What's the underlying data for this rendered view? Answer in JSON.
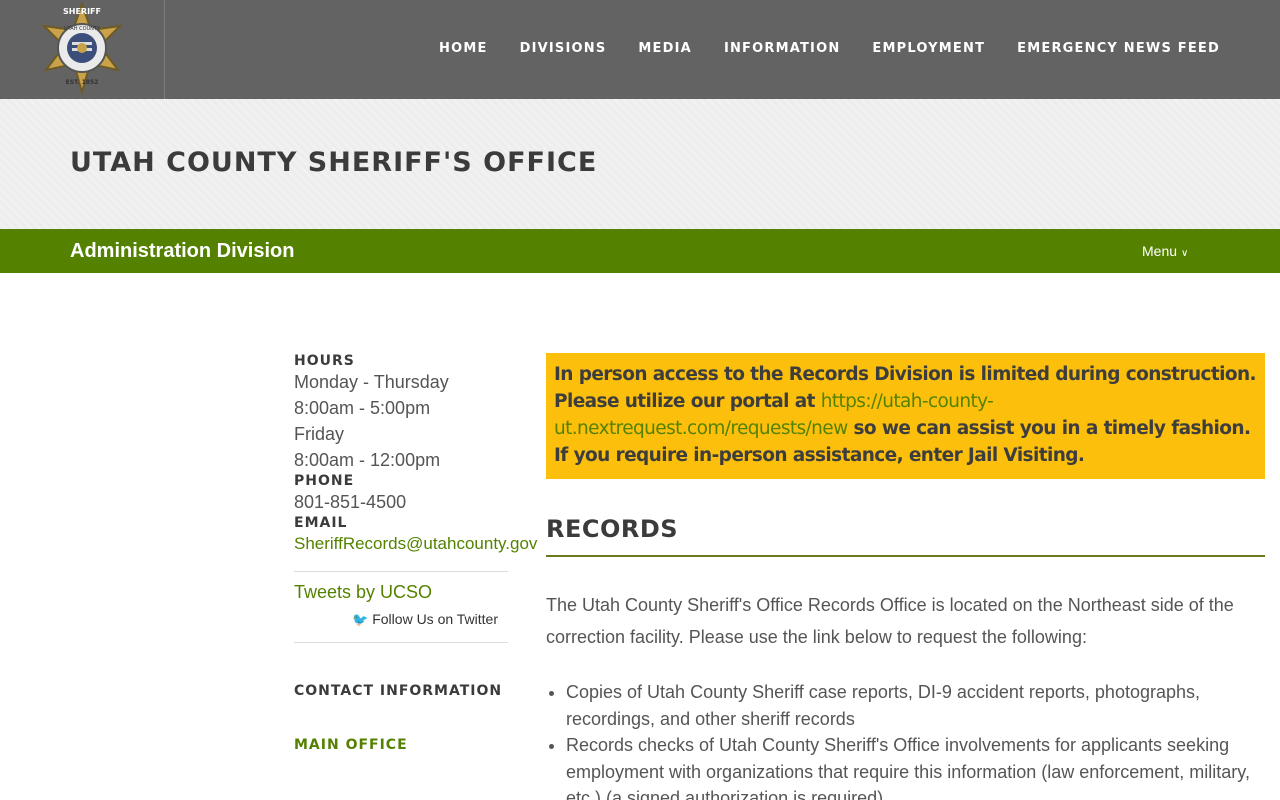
{
  "nav": {
    "items": [
      {
        "label": "HOME"
      },
      {
        "label": "DIVISIONS"
      },
      {
        "label": "MEDIA"
      },
      {
        "label": "INFORMATION"
      },
      {
        "label": "EMPLOYMENT"
      },
      {
        "label": "EMERGENCY NEWS FEED"
      }
    ]
  },
  "logo": {
    "top_text": "SHERIFF",
    "ring_text": "UTAH COUNTY",
    "bottom_text": "EST. 1852"
  },
  "page_title": "UTAH COUNTY SHERIFF'S OFFICE",
  "division": {
    "title": "Administration Division",
    "menu_label": "Menu"
  },
  "sidebar": {
    "hours_label": "HOURS",
    "hours": [
      "Monday - Thursday",
      "8:00am - 5:00pm",
      "Friday",
      "8:00am - 12:00pm"
    ],
    "phone_label": "PHONE",
    "phone": "801-851-4500",
    "email_label": "EMAIL",
    "email": "SheriffRecords@utahcounty.gov",
    "tweets_link": "Tweets by UCSO",
    "follow_label": "Follow Us on Twitter",
    "contact_label": "CONTACT INFORMATION",
    "main_office_label": "MAIN OFFICE"
  },
  "notice": {
    "text_before": "In person access to the Records Division is limited during construction. Please utilize our portal at ",
    "link": "https://utah-county-ut.nextrequest.com/requests/new",
    "text_after": " so we can assist you in a timely fashion. If you require in-person assistance, enter Jail Visiting."
  },
  "records": {
    "title": "RECORDS",
    "intro": "The Utah County Sheriff's Office Records Office is located on the Northeast side of the correction facility. Please use the link below to request the following:",
    "bullets": [
      "Copies of Utah County Sheriff case reports, DI-9 accident reports, photographs, recordings, and other sheriff records",
      "Records checks of Utah County Sheriff's Office involvements for applicants seeking employment with organizations that require this information (law enforcement, military, etc.) (a signed authorization is required)"
    ]
  },
  "colors": {
    "header_bg": "#636363",
    "accent_green": "#548200",
    "notice_yellow": "#fcbf0c"
  }
}
